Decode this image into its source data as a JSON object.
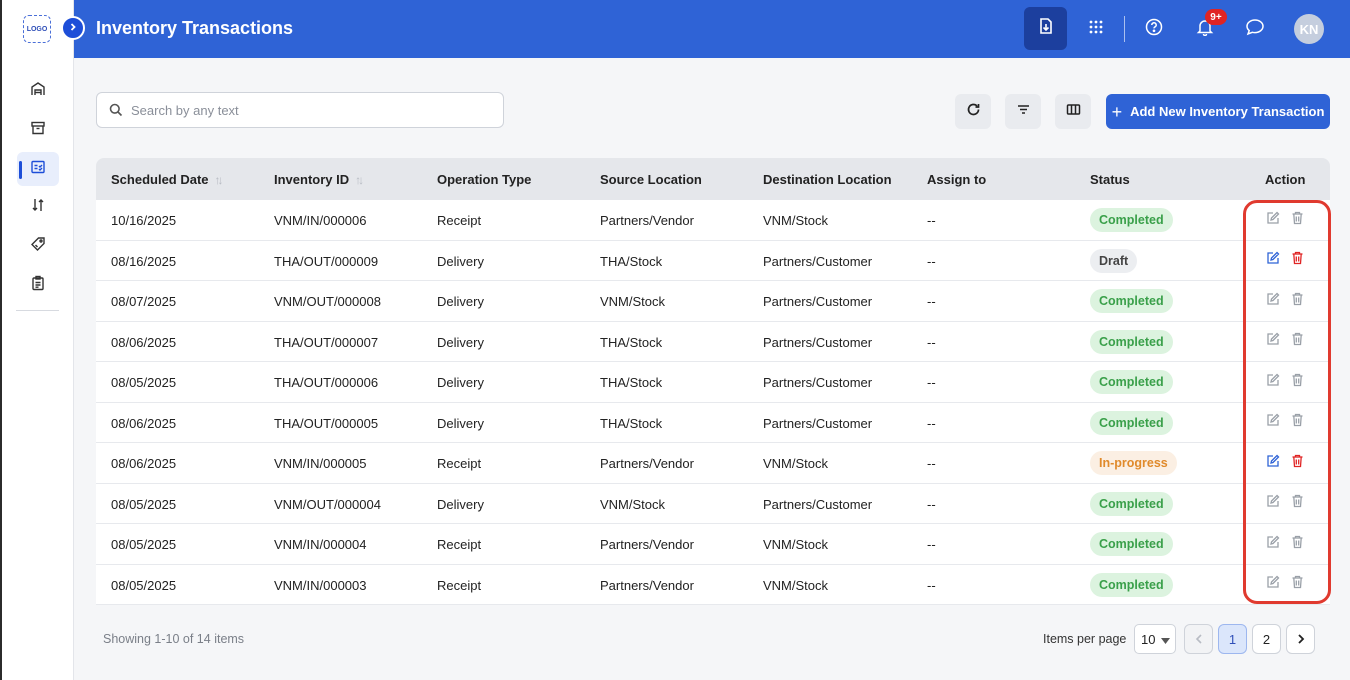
{
  "app": {
    "logo_text": "LOGO",
    "page_title": "Inventory Transactions"
  },
  "header": {
    "notification_count": "9+",
    "avatar_initials": "KN",
    "icons": [
      "download-icon",
      "apps-grid-icon",
      "help-icon",
      "bell-icon",
      "chat-icon"
    ]
  },
  "sidebar": {
    "items": [
      {
        "icon": "warehouse-icon",
        "active": false
      },
      {
        "icon": "archive-box-icon",
        "active": false
      },
      {
        "icon": "checklist-icon",
        "active": true
      },
      {
        "icon": "transfer-arrows-icon",
        "active": false
      },
      {
        "icon": "tag-icon",
        "active": false
      },
      {
        "icon": "clipboard-icon",
        "active": false
      }
    ]
  },
  "toolbar": {
    "search_placeholder": "Search by any text",
    "add_label": "Add New Inventory Transaction",
    "icons": [
      "refresh-icon",
      "filter-icon",
      "columns-icon"
    ]
  },
  "table": {
    "headers": [
      "Scheduled Date",
      "Inventory ID",
      "Operation Type",
      "Source Location",
      "Destination Location",
      "Assign to",
      "Status",
      "Action"
    ],
    "rows": [
      {
        "date": "10/16/2025",
        "id": "VNM/IN/000006",
        "op": "Receipt",
        "src": "Partners/Vendor",
        "dst": "VNM/Stock",
        "assign": "--",
        "status": "Completed"
      },
      {
        "date": "08/16/2025",
        "id": "THA/OUT/000009",
        "op": "Delivery",
        "src": "THA/Stock",
        "dst": "Partners/Customer",
        "assign": "--",
        "status": "Draft"
      },
      {
        "date": "08/07/2025",
        "id": "VNM/OUT/000008",
        "op": "Delivery",
        "src": "VNM/Stock",
        "dst": "Partners/Customer",
        "assign": "--",
        "status": "Completed"
      },
      {
        "date": "08/06/2025",
        "id": "THA/OUT/000007",
        "op": "Delivery",
        "src": "THA/Stock",
        "dst": "Partners/Customer",
        "assign": "--",
        "status": "Completed"
      },
      {
        "date": "08/05/2025",
        "id": "THA/OUT/000006",
        "op": "Delivery",
        "src": "THA/Stock",
        "dst": "Partners/Customer",
        "assign": "--",
        "status": "Completed"
      },
      {
        "date": "08/06/2025",
        "id": "THA/OUT/000005",
        "op": "Delivery",
        "src": "THA/Stock",
        "dst": "Partners/Customer",
        "assign": "--",
        "status": "Completed"
      },
      {
        "date": "08/06/2025",
        "id": "VNM/IN/000005",
        "op": "Receipt",
        "src": "Partners/Vendor",
        "dst": "VNM/Stock",
        "assign": "--",
        "status": "In-progress"
      },
      {
        "date": "08/05/2025",
        "id": "VNM/OUT/000004",
        "op": "Delivery",
        "src": "VNM/Stock",
        "dst": "Partners/Customer",
        "assign": "--",
        "status": "Completed"
      },
      {
        "date": "08/05/2025",
        "id": "VNM/IN/000004",
        "op": "Receipt",
        "src": "Partners/Vendor",
        "dst": "VNM/Stock",
        "assign": "--",
        "status": "Completed"
      },
      {
        "date": "08/05/2025",
        "id": "VNM/IN/000003",
        "op": "Receipt",
        "src": "Partners/Vendor",
        "dst": "VNM/Stock",
        "assign": "--",
        "status": "Completed"
      }
    ]
  },
  "footer": {
    "showing": "Showing 1-10 of 14 items",
    "items_per_page_label": "Items per page",
    "items_per_page_value": "10",
    "pages": [
      "1",
      "2"
    ],
    "current_page": "1"
  },
  "colors": {
    "primary": "#2f63d6",
    "completed": "#3aa04a",
    "in_progress": "#e08a2b",
    "delete_active": "#e02424",
    "highlight": "#e03a2f"
  }
}
